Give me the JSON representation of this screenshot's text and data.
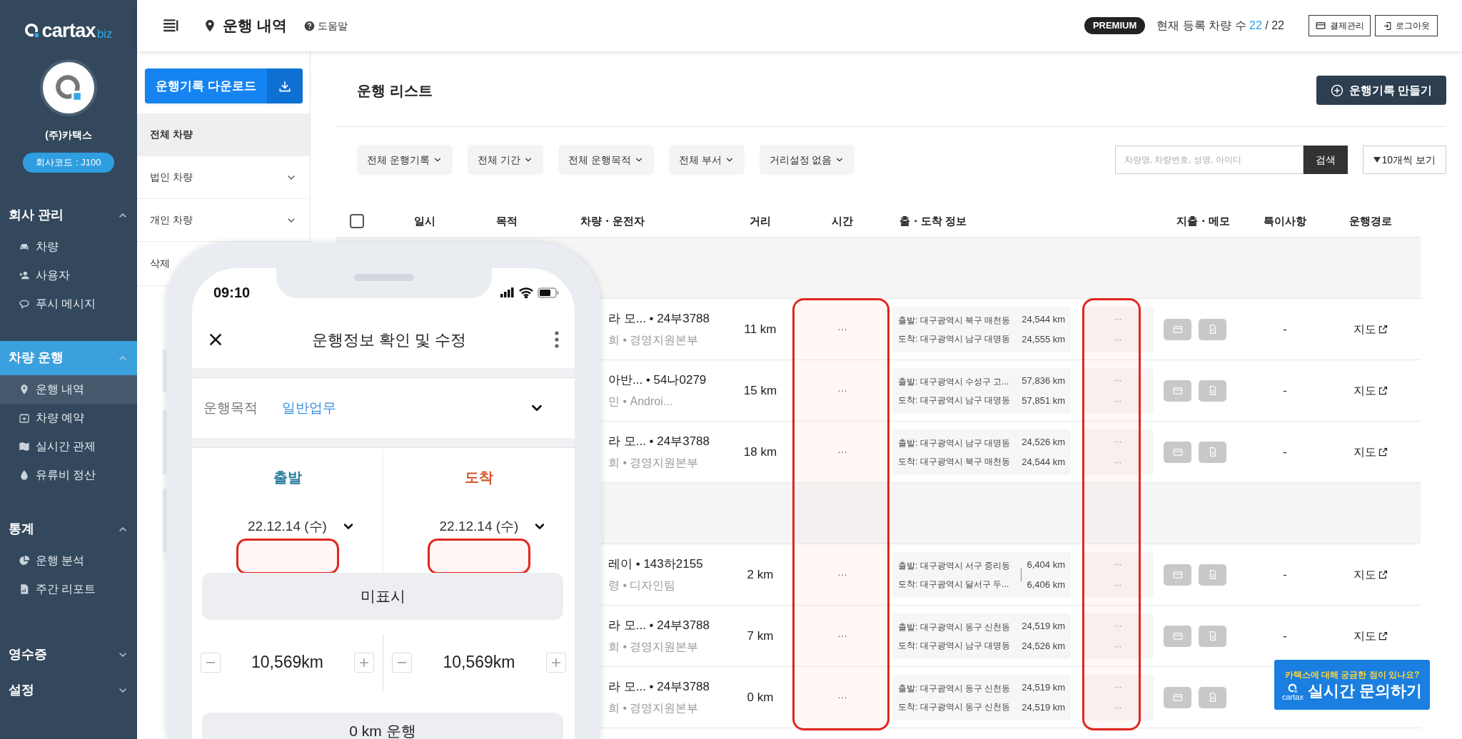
{
  "sidebar": {
    "logo": {
      "name": "cartax",
      "suffix": "biz"
    },
    "company": "(주)카택스",
    "company_code": "회사코드 : J100",
    "sections": [
      {
        "title": "회사 관리",
        "expanded": true,
        "selected": false,
        "items": [
          {
            "label": "차량",
            "selected": false
          },
          {
            "label": "사용자",
            "selected": false
          },
          {
            "label": "푸시 메시지",
            "selected": false
          }
        ]
      },
      {
        "title": "차량 운행",
        "expanded": true,
        "selected": true,
        "items": [
          {
            "label": "운행 내역",
            "selected": true
          },
          {
            "label": "차량 예약",
            "selected": false
          },
          {
            "label": "실시간 관제",
            "selected": false
          },
          {
            "label": "유류비 정산",
            "selected": false
          }
        ]
      },
      {
        "title": "통계",
        "expanded": true,
        "selected": false,
        "items": [
          {
            "label": "운행 분석",
            "selected": false
          },
          {
            "label": "주간 리포트",
            "selected": false
          }
        ]
      },
      {
        "title": "영수증",
        "expanded": false,
        "selected": false
      },
      {
        "title": "설정",
        "expanded": false,
        "selected": false
      }
    ]
  },
  "topbar": {
    "page_title": "운행 내역",
    "help": "도움말",
    "plan": "PREMIUM",
    "vehicle_count_label": "현재 등록 차량 수",
    "vehicle_count": "22",
    "vehicle_limit": "/ 22",
    "billing_button": "결제관리",
    "logout_button": "로그아웃"
  },
  "panel": {
    "download_button": "운행기록 다운로드",
    "vehicle_groups": [
      {
        "label": "전체 차량",
        "selected": true,
        "expandable": false
      },
      {
        "label": "법인 차량",
        "selected": false,
        "expandable": true
      },
      {
        "label": "개인 차량",
        "selected": false,
        "expandable": true
      }
    ],
    "partial_group": "삭제"
  },
  "main": {
    "title": "운행 리스트",
    "create_button": "운행기록 만들기",
    "filters": [
      "전체 운행기록",
      "전체 기간",
      "전체 운행목적",
      "전체 부서",
      "거리설정 없음"
    ],
    "search": {
      "placeholder": "차량명, 차량번호, 성명, 아이디"
    },
    "search_button": "검색",
    "page_size_button": "10개씩 보기"
  },
  "table": {
    "select_all": {
      "checked": false
    },
    "columns": [
      "일시",
      "목적",
      "차량・운전자",
      "거리",
      "시간",
      "출・도착 정보",
      "지출・메모",
      "특이사항",
      "운행경로"
    ],
    "rows": [
      {
        "kind": "group"
      },
      {
        "kind": "trip",
        "vehicle": "라 모... • 24부3788",
        "driver": "희 • 경영지원본부",
        "distance": "11 km",
        "time": "···",
        "departure": "출발: 대구광역시 북구 매천동",
        "arrival": "도착: 대구광역시 남구 대명동",
        "km_start": "24,544 km",
        "km_end": "24,555 km",
        "times": [
          "···",
          "···"
        ],
        "remark": "-",
        "route": "지도"
      },
      {
        "kind": "trip",
        "vehicle": "아반... • 54나0279",
        "driver": "민 • Androi...",
        "distance": "15 km",
        "time": "···",
        "departure": "출발: 대구광역시 수성구 고...",
        "arrival": "도착: 대구광역시 남구 대명동",
        "km_start": "57,836 km",
        "km_end": "57,851 km",
        "times": [
          "···",
          "···"
        ],
        "remark": "-",
        "route": "지도"
      },
      {
        "kind": "trip",
        "vehicle": "라 모... • 24부3788",
        "driver": "희 • 경영지원본부",
        "distance": "18 km",
        "time": "···",
        "departure": "출발: 대구광역시 남구 대명동",
        "arrival": "도착: 대구광역시 북구 매천동",
        "km_start": "24,526 km",
        "km_end": "24,544 km",
        "times": [
          "···",
          "···"
        ],
        "remark": "-",
        "route": "지도"
      },
      {
        "kind": "group"
      },
      {
        "kind": "trip",
        "vehicle": "레이 • 143하2155",
        "driver": "령 • 디자인팀",
        "distance": "2 km",
        "time": "···",
        "departure": "출발: 대구광역시 서구 중리동",
        "arrival": "도착: 대구광역시 달서구 두...",
        "km_start": "6,404 km",
        "km_end": "6,406 km",
        "times": [
          "···",
          "···"
        ],
        "remark": "-",
        "route": "지도"
      },
      {
        "kind": "trip",
        "vehicle": "라 모... • 24부3788",
        "driver": "희 • 경영지원본부",
        "distance": "7 km",
        "time": "···",
        "departure": "출발: 대구광역시 동구 신천동",
        "arrival": "도착: 대구광역시 남구 대명동",
        "km_start": "24,519 km",
        "km_end": "24,526 km",
        "times": [
          "···",
          "···"
        ],
        "remark": "-",
        "route": "지도"
      },
      {
        "kind": "trip",
        "vehicle": "라 모... • 24부3788",
        "driver": "희 • 경영지원본부",
        "distance": "0 km",
        "time": "···",
        "departure": "출발: 대구광역시 동구 신천동",
        "arrival": "도착: 대구광역시 동구 신천동",
        "km_start": "24,519 km",
        "km_end": "24,519 km",
        "times": [
          "···",
          "···"
        ]
      }
    ]
  },
  "phone": {
    "time": "09:10",
    "title": "운행정보 확인 및 수정",
    "purpose_label": "운행목적",
    "purpose_value": "일반업무",
    "endpoints": [
      {
        "label": "출발",
        "color": "#2a7c9c",
        "date": "22.12.14 (수)",
        "odometer": "10,569km"
      },
      {
        "label": "도착",
        "color": "#d35428",
        "date": "22.12.14 (수)",
        "odometer": "10,569km"
      }
    ],
    "location_button": "미표시",
    "distance_button": "0 km 운행"
  },
  "chat_widget": {
    "prompt": "카택스에 대해 궁금한 점이 있나요?",
    "brand": "cartax",
    "label": "실시간 문의하기"
  }
}
